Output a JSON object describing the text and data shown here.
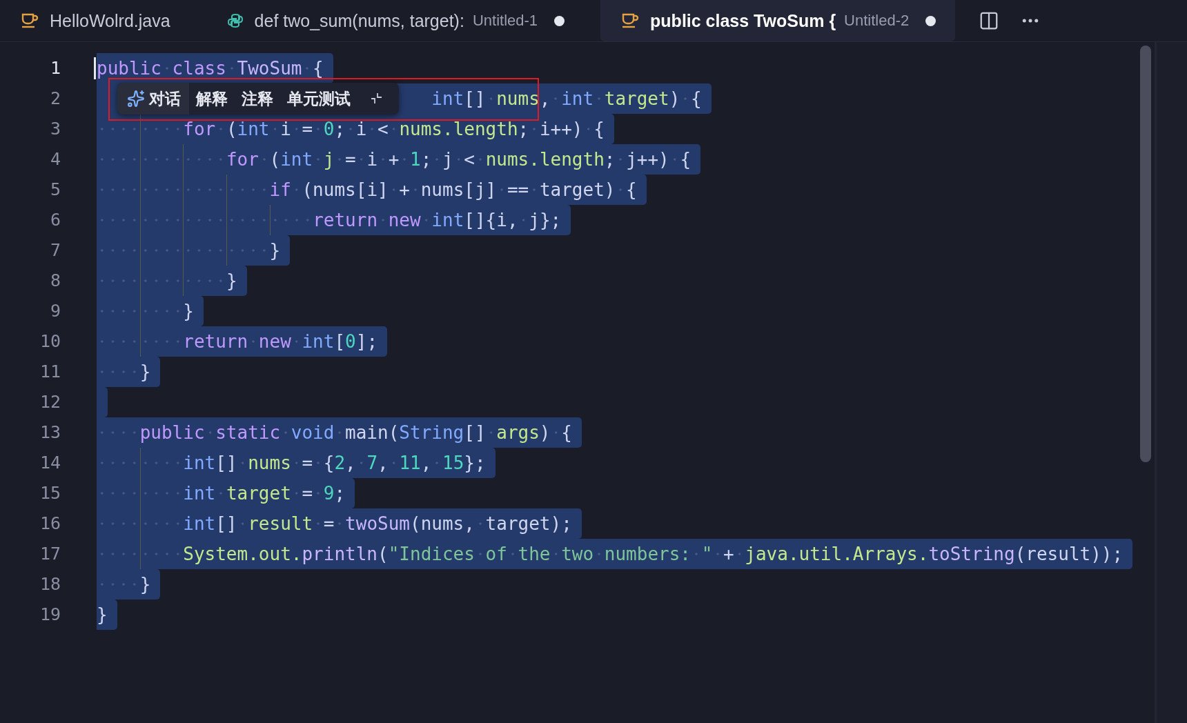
{
  "tabs": [
    {
      "kind": "java",
      "label": "HelloWolrd.java",
      "selected": false,
      "modified": false
    },
    {
      "kind": "python",
      "label": "def two_sum(nums, target):",
      "description": "Untitled-1",
      "selected": false,
      "modified": true
    },
    {
      "kind": "java",
      "label": "public class TwoSum {",
      "description": "Untitled-2",
      "selected": true,
      "modified": true
    }
  ],
  "editor": {
    "lines": [
      {
        "number": "1",
        "current": true,
        "selected": true,
        "covered": false,
        "tokens": [
          {
            "text": "public ",
            "kind": "keyword"
          },
          {
            "text": "class ",
            "kind": "keyword"
          },
          {
            "text": "TwoSum ",
            "kind": "function"
          },
          {
            "text": "{",
            "kind": "plain"
          }
        ]
      },
      {
        "number": "2",
        "current": false,
        "selected": true,
        "covered": true,
        "tokens": [
          {
            "text": "int",
            "kind": "type"
          },
          {
            "text": "[] ",
            "kind": "plain"
          },
          {
            "text": "nums",
            "kind": "variable"
          },
          {
            "text": ", ",
            "kind": "plain"
          },
          {
            "text": "int ",
            "kind": "type"
          },
          {
            "text": "target",
            "kind": "variable"
          },
          {
            "text": ") {",
            "kind": "plain"
          }
        ]
      },
      {
        "number": "3",
        "current": false,
        "selected": true,
        "covered": false,
        "tokens": [
          {
            "text": "        for ",
            "kind": "keyword"
          },
          {
            "text": "(",
            "kind": "plain"
          },
          {
            "text": "int ",
            "kind": "type"
          },
          {
            "text": "i = ",
            "kind": "plain"
          },
          {
            "text": "0",
            "kind": "number"
          },
          {
            "text": "; i < ",
            "kind": "plain"
          },
          {
            "text": "nums.length",
            "kind": "variable"
          },
          {
            "text": "; i++) {",
            "kind": "plain"
          }
        ]
      },
      {
        "number": "4",
        "current": false,
        "selected": true,
        "covered": false,
        "tokens": [
          {
            "text": "            for ",
            "kind": "keyword"
          },
          {
            "text": "(",
            "kind": "plain"
          },
          {
            "text": "int ",
            "kind": "type"
          },
          {
            "text": "j",
            "kind": "variable"
          },
          {
            "text": " = i + ",
            "kind": "plain"
          },
          {
            "text": "1",
            "kind": "number"
          },
          {
            "text": "; j < ",
            "kind": "plain"
          },
          {
            "text": "nums.length",
            "kind": "variable"
          },
          {
            "text": "; j++) {",
            "kind": "plain"
          }
        ]
      },
      {
        "number": "5",
        "current": false,
        "selected": true,
        "covered": false,
        "tokens": [
          {
            "text": "                if ",
            "kind": "keyword"
          },
          {
            "text": "(nums[i] + nums[j] == target) {",
            "kind": "plain"
          }
        ]
      },
      {
        "number": "6",
        "current": false,
        "selected": true,
        "covered": false,
        "tokens": [
          {
            "text": "                    return new ",
            "kind": "keyword"
          },
          {
            "text": "int",
            "kind": "type"
          },
          {
            "text": "[]{i, j};",
            "kind": "plain"
          }
        ]
      },
      {
        "number": "7",
        "current": false,
        "selected": true,
        "covered": false,
        "tokens": [
          {
            "text": "                }",
            "kind": "plain"
          }
        ]
      },
      {
        "number": "8",
        "current": false,
        "selected": true,
        "covered": false,
        "tokens": [
          {
            "text": "            }",
            "kind": "plain"
          }
        ]
      },
      {
        "number": "9",
        "current": false,
        "selected": true,
        "covered": false,
        "tokens": [
          {
            "text": "        }",
            "kind": "plain"
          }
        ]
      },
      {
        "number": "10",
        "current": false,
        "selected": true,
        "covered": false,
        "tokens": [
          {
            "text": "        return new ",
            "kind": "keyword"
          },
          {
            "text": "int",
            "kind": "type"
          },
          {
            "text": "[",
            "kind": "plain"
          },
          {
            "text": "0",
            "kind": "number"
          },
          {
            "text": "];",
            "kind": "plain"
          }
        ]
      },
      {
        "number": "11",
        "current": false,
        "selected": true,
        "covered": false,
        "tokens": [
          {
            "text": "    }",
            "kind": "plain"
          }
        ]
      },
      {
        "number": "12",
        "current": false,
        "selected": true,
        "covered": false
      },
      {
        "number": "13",
        "current": false,
        "selected": true,
        "covered": false,
        "tokens": [
          {
            "text": "    public static ",
            "kind": "keyword"
          },
          {
            "text": "void ",
            "kind": "type"
          },
          {
            "text": "main(",
            "kind": "plain"
          },
          {
            "text": "String",
            "kind": "type"
          },
          {
            "text": "[] ",
            "kind": "plain"
          },
          {
            "text": "args",
            "kind": "variable"
          },
          {
            "text": ") {",
            "kind": "plain"
          }
        ]
      },
      {
        "number": "14",
        "current": false,
        "selected": true,
        "covered": false,
        "tokens": [
          {
            "text": "        int",
            "kind": "type"
          },
          {
            "text": "[] ",
            "kind": "plain"
          },
          {
            "text": "nums",
            "kind": "variable"
          },
          {
            "text": " = {",
            "kind": "plain"
          },
          {
            "text": "2",
            "kind": "number"
          },
          {
            "text": ", ",
            "kind": "plain"
          },
          {
            "text": "7",
            "kind": "number"
          },
          {
            "text": ", ",
            "kind": "plain"
          },
          {
            "text": "11",
            "kind": "number"
          },
          {
            "text": ", ",
            "kind": "plain"
          },
          {
            "text": "15",
            "kind": "number"
          },
          {
            "text": "};",
            "kind": "plain"
          }
        ]
      },
      {
        "number": "15",
        "current": false,
        "selected": true,
        "covered": false,
        "tokens": [
          {
            "text": "        int ",
            "kind": "type"
          },
          {
            "text": "target",
            "kind": "variable"
          },
          {
            "text": " = ",
            "kind": "plain"
          },
          {
            "text": "9",
            "kind": "number"
          },
          {
            "text": ";",
            "kind": "plain"
          }
        ]
      },
      {
        "number": "16",
        "current": false,
        "selected": true,
        "covered": false,
        "tokens": [
          {
            "text": "        int",
            "kind": "type"
          },
          {
            "text": "[] ",
            "kind": "plain"
          },
          {
            "text": "result",
            "kind": "variable"
          },
          {
            "text": " = ",
            "kind": "plain"
          },
          {
            "text": "twoSum",
            "kind": "function"
          },
          {
            "text": "(nums, target);",
            "kind": "plain"
          }
        ]
      },
      {
        "number": "17",
        "current": false,
        "selected": true,
        "covered": false,
        "tokens": [
          {
            "text": "        System.out.",
            "kind": "variable"
          },
          {
            "text": "println",
            "kind": "function"
          },
          {
            "text": "(",
            "kind": "plain"
          },
          {
            "text": "\"Indices of the two numbers: \"",
            "kind": "string"
          },
          {
            "text": " + ",
            "kind": "plain"
          },
          {
            "text": "java.util.Arrays.",
            "kind": "variable"
          },
          {
            "text": "toString",
            "kind": "function"
          },
          {
            "text": "(result));",
            "kind": "plain"
          }
        ]
      },
      {
        "number": "18",
        "current": false,
        "selected": true,
        "covered": false,
        "tokens": [
          {
            "text": "    }",
            "kind": "plain"
          }
        ]
      },
      {
        "number": "19",
        "current": false,
        "selected": true,
        "covered": false,
        "tokens": [
          {
            "text": "}",
            "kind": "plain"
          }
        ]
      }
    ]
  },
  "ai_toolbar": {
    "actions": [
      {
        "label": "对话",
        "kind": "chat"
      },
      {
        "label": "解释",
        "kind": "plain"
      },
      {
        "label": "注释",
        "kind": "plain"
      },
      {
        "label": "单元测试",
        "kind": "plain"
      }
    ]
  }
}
